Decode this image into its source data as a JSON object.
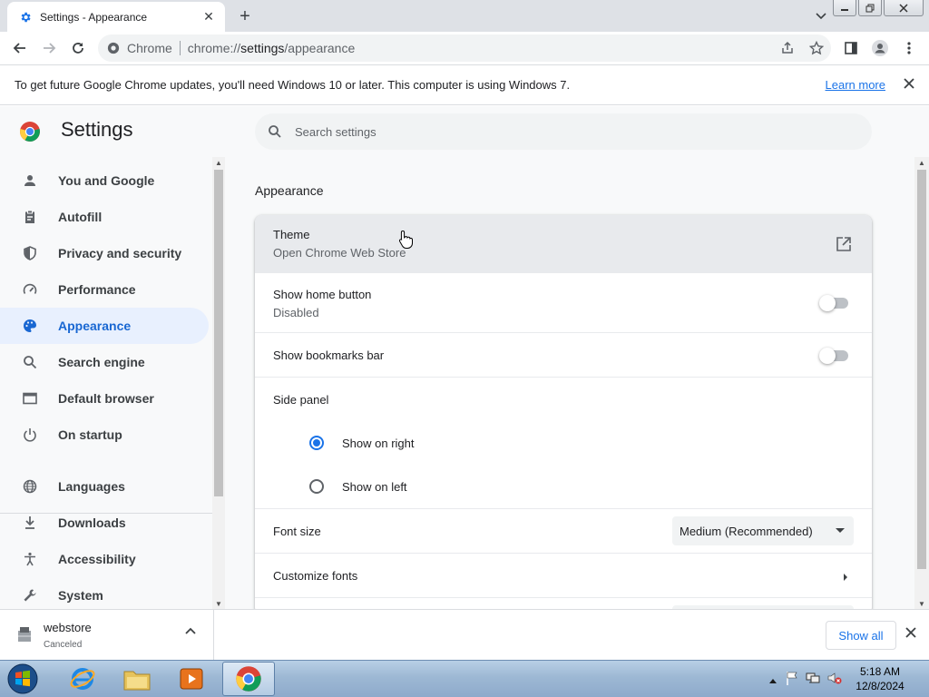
{
  "window": {
    "tab_title": "Settings - Appearance",
    "close_tab": "✕",
    "new_tab": "+"
  },
  "toolbar": {
    "site_chip": "Chrome",
    "url_scheme": "chrome://",
    "url_host": "settings",
    "url_path": "/appearance"
  },
  "infobar": {
    "message": "To get future Google Chrome updates, you'll need Windows 10 or later. This computer is using Windows 7.",
    "link": "Learn more"
  },
  "settings": {
    "title": "Settings",
    "search_placeholder": "Search settings",
    "nav": [
      {
        "label": "You and Google",
        "icon": "person-icon"
      },
      {
        "label": "Autofill",
        "icon": "clipboard-icon"
      },
      {
        "label": "Privacy and security",
        "icon": "shield-icon"
      },
      {
        "label": "Performance",
        "icon": "speedometer-icon"
      },
      {
        "label": "Appearance",
        "icon": "palette-icon",
        "active": true
      },
      {
        "label": "Search engine",
        "icon": "search-icon"
      },
      {
        "label": "Default browser",
        "icon": "browser-icon"
      },
      {
        "label": "On startup",
        "icon": "power-icon"
      },
      {
        "label": "Languages",
        "icon": "globe-icon"
      },
      {
        "label": "Downloads",
        "icon": "download-icon"
      },
      {
        "label": "Accessibility",
        "icon": "accessibility-icon"
      },
      {
        "label": "System",
        "icon": "wrench-icon"
      }
    ],
    "section_title": "Appearance",
    "theme": {
      "label": "Theme",
      "sublabel": "Open Chrome Web Store"
    },
    "home_button": {
      "label": "Show home button",
      "sublabel": "Disabled",
      "enabled": false
    },
    "bookmarks_bar": {
      "label": "Show bookmarks bar",
      "enabled": false
    },
    "side_panel": {
      "label": "Side panel",
      "options": [
        "Show on right",
        "Show on left"
      ],
      "selected": "Show on right"
    },
    "font_size": {
      "label": "Font size",
      "value": "Medium (Recommended)"
    },
    "customize_fonts": {
      "label": "Customize fonts"
    }
  },
  "download_shelf": {
    "filename": "webstore",
    "status": "Canceled",
    "show_all": "Show all"
  },
  "taskbar": {
    "time": "5:18 AM",
    "date": "12/8/2024"
  },
  "colors": {
    "accent": "#1a73e8",
    "nav_active_bg": "#e8f0fe",
    "nav_active_text": "#1967d2"
  }
}
